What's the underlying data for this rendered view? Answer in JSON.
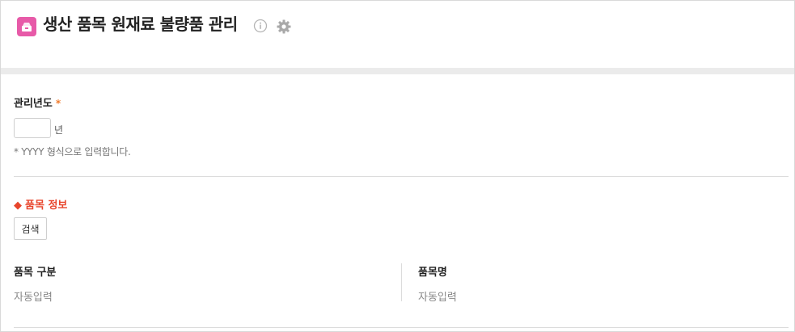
{
  "header": {
    "title": "생산 품목 원재료 불량품 관리",
    "app_icon": "box-icon",
    "info_icon": "info-icon",
    "settings_icon": "gear-icon",
    "icon_color": "#e75aa8"
  },
  "form": {
    "year_label": "관리년도",
    "required_mark": "*",
    "year_value": "",
    "year_unit": "년",
    "year_hint": "* YYYY 형식으로 입력합니다."
  },
  "item_section": {
    "title": "품목 정보",
    "marker": "◆",
    "title_color": "#e8452c",
    "search_label": "검색",
    "fields": [
      {
        "label": "품목 구분",
        "value": "자동입력"
      },
      {
        "label": "품목명",
        "value": "자동입력"
      }
    ]
  }
}
